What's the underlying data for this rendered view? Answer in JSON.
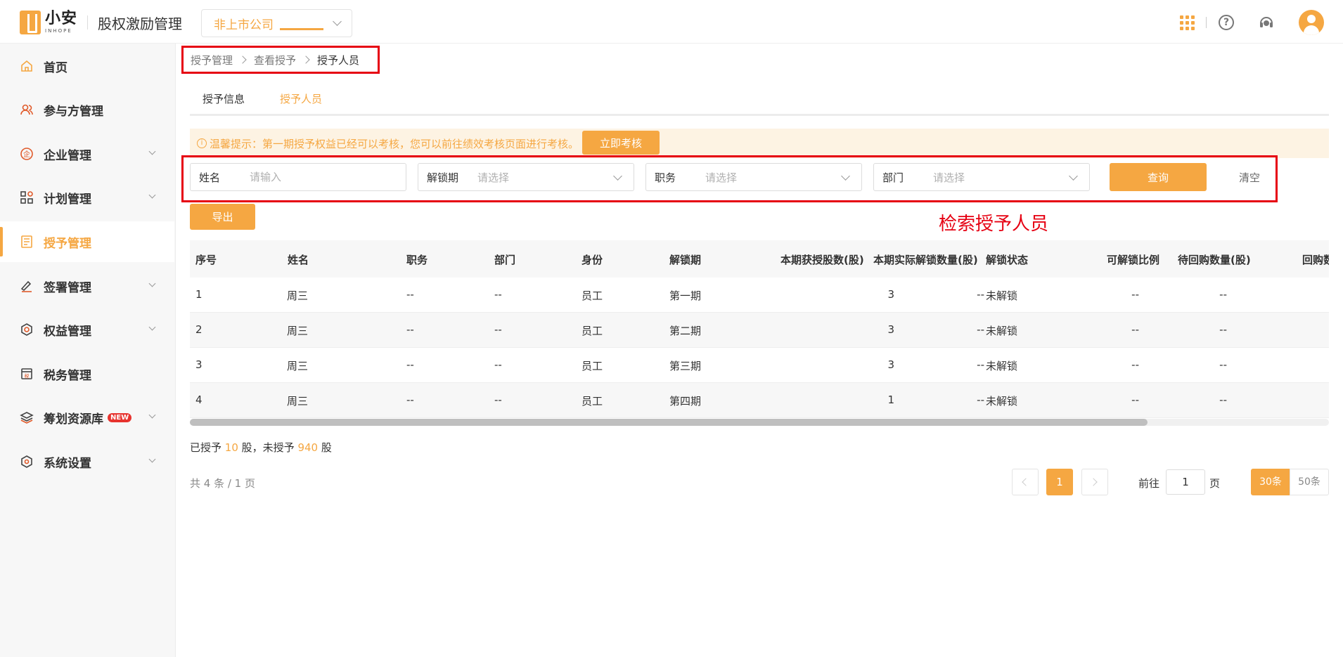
{
  "header": {
    "logo_cn": "小安",
    "logo_en": "INHOPE",
    "system_title": "股权激励管理",
    "company_select": "非上市公司",
    "colors": {
      "accent": "#f5a742",
      "annotation": "#e60012"
    }
  },
  "sidebar": {
    "items": [
      {
        "label": "首页",
        "icon": "home-icon"
      },
      {
        "label": "参与方管理",
        "icon": "users-icon"
      },
      {
        "label": "企业管理",
        "icon": "enterprise-icon"
      },
      {
        "label": "计划管理",
        "icon": "grid-plan-icon"
      },
      {
        "label": "授予管理",
        "icon": "grant-doc-icon",
        "active": true
      },
      {
        "label": "签署管理",
        "icon": "sign-icon"
      },
      {
        "label": "权益管理",
        "icon": "equity-icon"
      },
      {
        "label": "税务管理",
        "icon": "tax-icon"
      },
      {
        "label": "筹划资源库",
        "icon": "layers-icon",
        "badge": "NEW"
      },
      {
        "label": "系统设置",
        "icon": "settings-icon"
      }
    ]
  },
  "breadcrumb": [
    "授予管理",
    "查看授予",
    "授予人员"
  ],
  "tabs": [
    {
      "label": "授予信息"
    },
    {
      "label": "授予人员",
      "active": true
    }
  ],
  "tip": {
    "text": "温馨提示：第一期授予权益已经可以考核，您可以前往绩效考核页面进行考核。",
    "button": "立即考核"
  },
  "search": {
    "name_label": "姓名",
    "name_placeholder": "请输入",
    "unlock_label": "解锁期",
    "unlock_placeholder": "请选择",
    "position_label": "职务",
    "position_placeholder": "请选择",
    "dept_label": "部门",
    "dept_placeholder": "请选择",
    "query_button": "查询",
    "clear_button": "清空"
  },
  "export_button": "导出",
  "annotation": "检索授予人员",
  "table": {
    "headers": [
      "序号",
      "姓名",
      "职务",
      "部门",
      "身份",
      "解锁期",
      "本期获授股数(股)",
      "本期实际解锁数量(股)",
      "解锁状态",
      "可解锁比例",
      "待回购数量(股)",
      "回购数"
    ],
    "rows": [
      [
        "1",
        "周三",
        "--",
        "--",
        "员工",
        "第一期",
        "3",
        "--",
        "未解锁",
        "--",
        "--"
      ],
      [
        "2",
        "周三",
        "--",
        "--",
        "员工",
        "第二期",
        "3",
        "--",
        "未解锁",
        "--",
        "--"
      ],
      [
        "3",
        "周三",
        "--",
        "--",
        "员工",
        "第三期",
        "3",
        "--",
        "未解锁",
        "--",
        "--"
      ],
      [
        "4",
        "周三",
        "--",
        "--",
        "员工",
        "第四期",
        "1",
        "--",
        "未解锁",
        "--",
        "--"
      ]
    ]
  },
  "summary": {
    "granted_prefix": "已授予",
    "granted_value": "10",
    "granted_suffix": "股，未授予",
    "ungranted_value": "940",
    "ungranted_suffix": "股"
  },
  "pagination": {
    "total_text": "共 4 条 / 1 页",
    "current_page": "1",
    "goto_label": "前往",
    "goto_value": "1",
    "goto_suffix": "页",
    "sizes": [
      "30条",
      "50条"
    ],
    "active_size": "30条"
  }
}
